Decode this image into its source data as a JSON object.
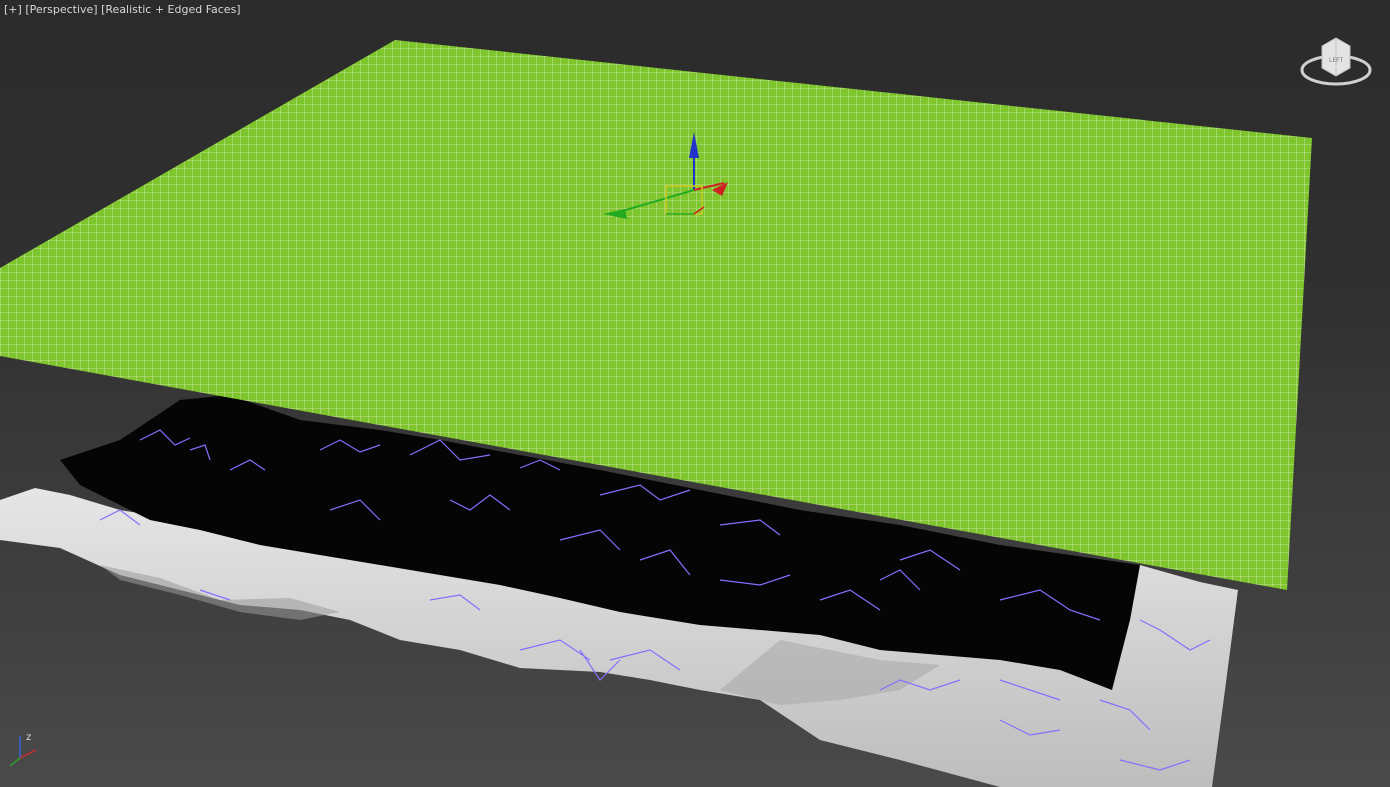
{
  "viewport": {
    "label_plus": "[+]",
    "label_view": "[Perspective]",
    "label_shading": "[Realistic + Edged Faces]"
  },
  "viewcube": {
    "face_label": "LEFT",
    "icon": "viewcube-icon"
  },
  "axis_tripod": {
    "z_label": "z",
    "icon": "axis-tripod-icon"
  },
  "gizmo": {
    "icon": "move-gizmo-icon",
    "colors": {
      "x": "#cc2222",
      "y": "#22aa22",
      "z": "#2233cc"
    }
  },
  "colors": {
    "plane": "#7fc62e",
    "plane_grid": "#e8f5d0",
    "terrain_light": "#d8d8d8",
    "terrain_dark": "#050505",
    "scatter_lines": "#8a6cff",
    "background": "#333333"
  }
}
